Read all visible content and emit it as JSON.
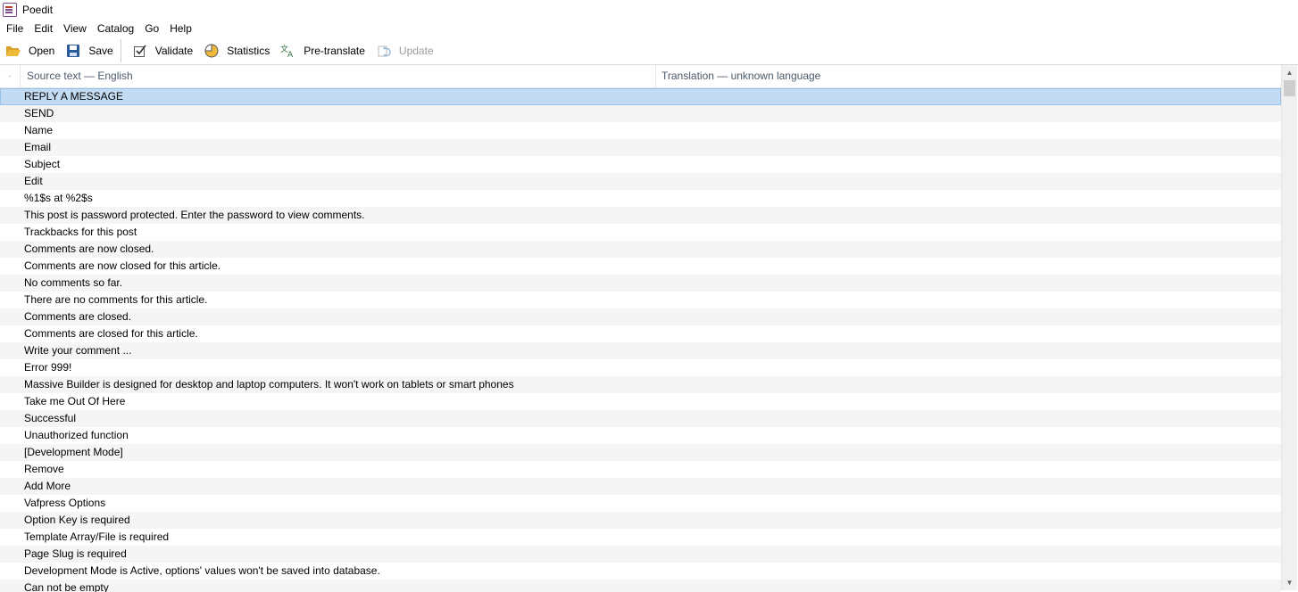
{
  "window": {
    "title": "Poedit"
  },
  "menu": [
    "File",
    "Edit",
    "View",
    "Catalog",
    "Go",
    "Help"
  ],
  "toolbar": {
    "open": "Open",
    "save": "Save",
    "validate": "Validate",
    "statistics": "Statistics",
    "pretranslate": "Pre-translate",
    "update": "Update"
  },
  "columns": {
    "marker": "·",
    "source": "Source text — English",
    "translation": "Translation — unknown language"
  },
  "rows": [
    "REPLY A MESSAGE",
    "SEND",
    "Name",
    "Email",
    "Subject",
    "Edit",
    "%1$s at %2$s",
    "This post is password protected. Enter the password to view comments.",
    "Trackbacks for this post",
    "Comments are now closed.",
    "Comments are now closed for this article.",
    "No comments so far.",
    "There are no comments for this article.",
    "Comments are closed.",
    "Comments are closed for this article.",
    "Write your comment ...",
    "Error 999!",
    "Massive Builder is designed for desktop and laptop computers. It won't work on tablets or smart phones",
    "Take me Out Of Here",
    "Successful",
    "Unauthorized function",
    "[Development Mode]",
    "Remove",
    "Add More",
    "Vafpress Options",
    "Option Key is required",
    "Template Array/File is required",
    "Page Slug is required",
    "Development Mode is Active, options' values won't be saved into database.",
    "Can not be empty"
  ],
  "selected_row_index": 0,
  "colors": {
    "selection": "#c4dcf3",
    "header_text": "#4a5a6a",
    "disabled": "#9a9a9a"
  }
}
